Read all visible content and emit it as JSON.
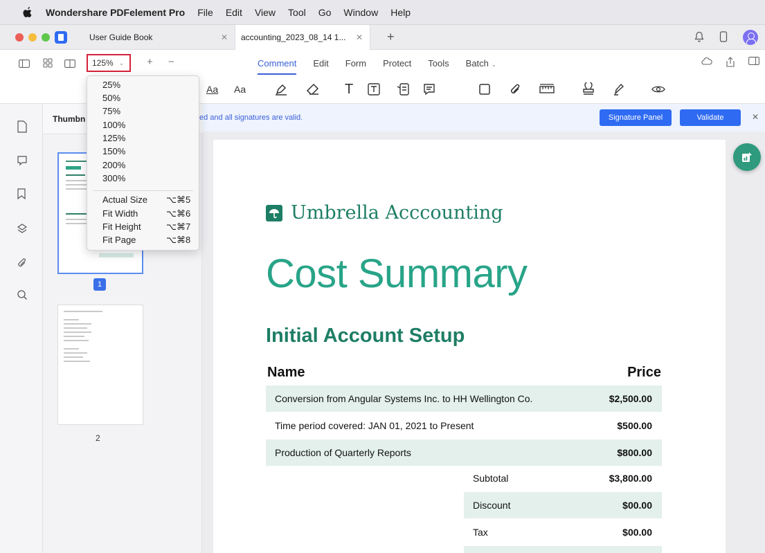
{
  "menubar": {
    "app_name": "Wondershare PDFelement Pro",
    "items": [
      "File",
      "Edit",
      "View",
      "Tool",
      "Go",
      "Window",
      "Help"
    ]
  },
  "tabs": [
    {
      "label": "User Guide Book",
      "active": false
    },
    {
      "label": "accounting_2023_08_14 1...",
      "active": true
    }
  ],
  "toolbar": {
    "zoom_value": "125%",
    "mode_tabs": [
      "Comment",
      "Edit",
      "Form",
      "Protect",
      "Tools",
      "Batch"
    ],
    "active_mode": "Comment",
    "text_tool_1": "Aa",
    "text_tool_2": "Aa"
  },
  "zoom_menu": {
    "levels": [
      "25%",
      "50%",
      "75%",
      "100%",
      "125%",
      "150%",
      "200%",
      "300%"
    ],
    "fit_options": [
      {
        "label": "Actual Size",
        "shortcut": "⌥⌘5"
      },
      {
        "label": "Fit Width",
        "shortcut": "⌥⌘6"
      },
      {
        "label": "Fit Height",
        "shortcut": "⌥⌘7"
      },
      {
        "label": "Fit Page",
        "shortcut": "⌥⌘8"
      }
    ]
  },
  "sidebar": {
    "panel_title": "Thumbn",
    "pages": [
      "1",
      "2"
    ]
  },
  "signature_banner": {
    "message": "ed and all signatures are valid.",
    "panel_button": "Signature Panel",
    "validate_button": "Validate"
  },
  "document": {
    "brand": "Umbrella Acccounting",
    "title": "Cost Summary",
    "section": "Initial Account Setup",
    "col_name": "Name",
    "col_price": "Price",
    "rows": [
      {
        "name": "Conversion from Angular Systems Inc. to HH Wellington Co.",
        "price": "$2,500.00"
      },
      {
        "name": "Time period covered: JAN 01, 2021 to Present",
        "price": "$500.00"
      },
      {
        "name": "Production of Quarterly Reports",
        "price": "$800.00"
      }
    ],
    "summary": [
      {
        "label": "Subtotal",
        "value": "$3,800.00"
      },
      {
        "label": "Discount",
        "value": "$00.00"
      },
      {
        "label": "Tax",
        "value": "$00.00"
      }
    ]
  },
  "colors": {
    "accent": "#2f6bf2",
    "brand_green": "#1e7e65",
    "title_teal": "#28a488",
    "row_shade": "#e3f0ec",
    "highlight_border": "#d6213a"
  }
}
